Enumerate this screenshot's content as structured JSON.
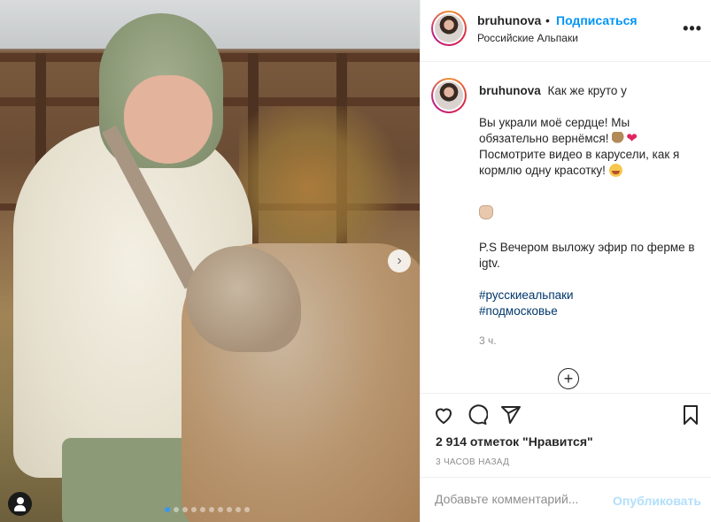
{
  "post": {
    "username": "bruhunova",
    "follow_label": "Подписаться",
    "separator": "•",
    "location": "Российские Альпаки",
    "more_icon": "•••"
  },
  "caption": {
    "username": "bruhunova",
    "line1": "Как же круто у",
    "para2": "Вы украли моё сердце! Мы обязательно вернёмся!",
    "para2b": "Посмотрите видео в карусели, как я кормлю одну красотку!",
    "para4": "P.S Вечером выложу эфир по ферме в igtv.",
    "hashtags": [
      "#русскиеальпаки",
      "#подмосковье"
    ],
    "time": "3 ч."
  },
  "actions": {
    "likes": "2 914 отметок \"Нравится\"",
    "posted_ago": "3 ЧАСОВ НАЗАД"
  },
  "comment": {
    "placeholder": "Добавьте комментарий...",
    "post_label": "Опубликовать"
  },
  "carousel": {
    "next_icon": "›",
    "slide_count": 10,
    "active_slide": 1
  },
  "colors": {
    "accent": "#0095f6",
    "post_disabled": "#b2dffc",
    "hashtag": "#00376b",
    "muted": "#8e8e8e"
  }
}
